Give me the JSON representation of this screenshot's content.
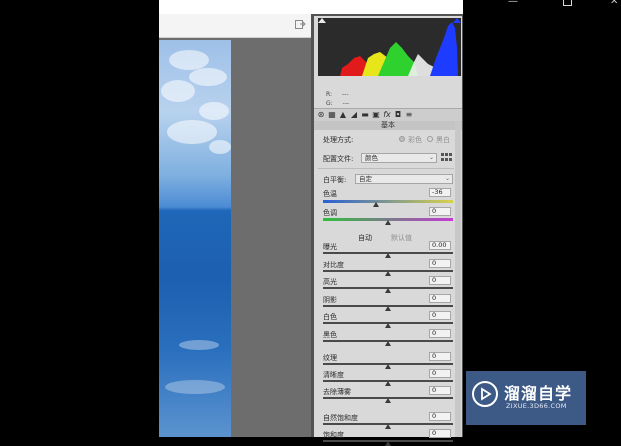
{
  "window_controls": {
    "minimize": "—",
    "maximize": "☐",
    "close": "✕"
  },
  "histogram": {
    "readouts": [
      {
        "channel": "R:",
        "value": "---"
      },
      {
        "channel": "G:",
        "value": "---"
      },
      {
        "channel": "B:",
        "value": "---"
      }
    ],
    "colors": {
      "red": "#e11b1b",
      "green": "#2fd12f",
      "blue": "#1e3cff",
      "yellow": "#e6e61a",
      "white": "#f2f2f2"
    }
  },
  "tools": [
    "aperture-icon",
    "curve-icon",
    "mountain-icon",
    "split-icon",
    "bars-icon",
    "lens-icon",
    "fx-icon",
    "camera-icon",
    "presets-icon"
  ],
  "section_title": "基本",
  "process": {
    "label": "处理方式:",
    "options": [
      "彩色",
      "黑白"
    ],
    "selected": "彩色"
  },
  "profile": {
    "label": "配置文件:",
    "value": "颜色"
  },
  "white_balance": {
    "label": "白平衡:",
    "value": "自定"
  },
  "temperature": {
    "label": "色温",
    "value": "-36",
    "level": 0.41
  },
  "tint": {
    "label": "色调",
    "value": "0",
    "level": 0.5
  },
  "auto_default": {
    "auto": "自动",
    "default": "默认值"
  },
  "sliders_group1": [
    {
      "label": "曝光",
      "value": "0.00",
      "level": 0.5
    },
    {
      "label": "对比度",
      "value": "0",
      "level": 0.5
    },
    {
      "label": "高光",
      "value": "0",
      "level": 0.5
    },
    {
      "label": "阴影",
      "value": "0",
      "level": 0.5
    },
    {
      "label": "白色",
      "value": "0",
      "level": 0.5
    },
    {
      "label": "黑色",
      "value": "0",
      "level": 0.5
    }
  ],
  "sliders_group2": [
    {
      "label": "纹理",
      "value": "0",
      "level": 0.5
    },
    {
      "label": "清晰度",
      "value": "0",
      "level": 0.5
    },
    {
      "label": "去除薄雾",
      "value": "0",
      "level": 0.5
    }
  ],
  "sliders_group3": [
    {
      "label": "自然饱和度",
      "value": "0",
      "level": 0.5
    },
    {
      "label": "饱和度",
      "value": "0",
      "level": 0.5
    }
  ],
  "watermark": {
    "name": "溜溜自学",
    "url": "ZIXUE.3D66.COM"
  }
}
